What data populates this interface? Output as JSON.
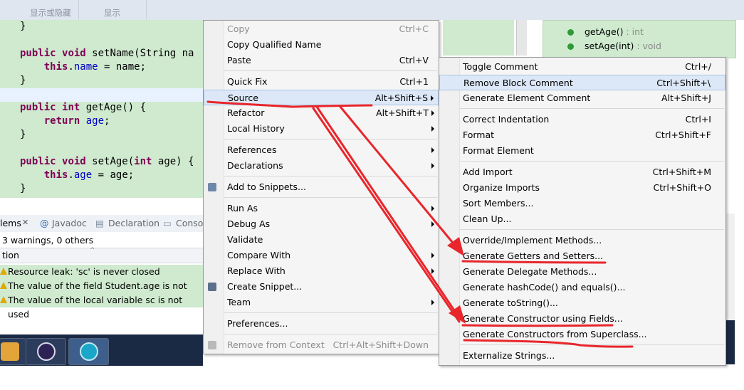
{
  "top_tabs": [
    "显示或隐藏",
    "显示"
  ],
  "editor": {
    "lines": [
      {
        "parts": [
          {
            "t": "}",
            "c": ""
          }
        ]
      },
      {
        "parts": []
      },
      {
        "parts": [
          {
            "t": "public",
            "c": "kw"
          },
          {
            "t": " ",
            "c": ""
          },
          {
            "t": "void",
            "c": "kw"
          },
          {
            "t": " setName(String na",
            "c": ""
          }
        ]
      },
      {
        "parts": [
          {
            "t": "    ",
            "c": ""
          },
          {
            "t": "this",
            "c": "kw"
          },
          {
            "t": ".",
            "c": ""
          },
          {
            "t": "name",
            "c": "fld"
          },
          {
            "t": " = name;",
            "c": ""
          }
        ]
      },
      {
        "parts": [
          {
            "t": "}",
            "c": ""
          }
        ]
      },
      {
        "parts": []
      },
      {
        "parts": [
          {
            "t": "public",
            "c": "kw"
          },
          {
            "t": " ",
            "c": ""
          },
          {
            "t": "int",
            "c": "kw"
          },
          {
            "t": " getAge() {",
            "c": ""
          }
        ]
      },
      {
        "parts": [
          {
            "t": "    ",
            "c": ""
          },
          {
            "t": "return",
            "c": "kw"
          },
          {
            "t": " ",
            "c": ""
          },
          {
            "t": "age",
            "c": "fld"
          },
          {
            "t": ";",
            "c": ""
          }
        ]
      },
      {
        "parts": [
          {
            "t": "}",
            "c": ""
          }
        ]
      },
      {
        "parts": []
      },
      {
        "parts": [
          {
            "t": "public",
            "c": "kw"
          },
          {
            "t": " ",
            "c": ""
          },
          {
            "t": "void",
            "c": "kw"
          },
          {
            "t": " setAge(",
            "c": ""
          },
          {
            "t": "int",
            "c": "kw"
          },
          {
            "t": " age) {",
            "c": ""
          }
        ]
      },
      {
        "parts": [
          {
            "t": "    ",
            "c": ""
          },
          {
            "t": "this",
            "c": "kw"
          },
          {
            "t": ".",
            "c": ""
          },
          {
            "t": "age",
            "c": "fld"
          },
          {
            "t": " = age;",
            "c": ""
          }
        ]
      },
      {
        "parts": [
          {
            "t": "}",
            "c": ""
          }
        ]
      }
    ]
  },
  "outline": {
    "items": [
      {
        "name": "getAge()",
        "type": " : int"
      },
      {
        "name": "setAge(int)",
        "type": " : void"
      }
    ]
  },
  "bottom_tabs": {
    "problems": "lems",
    "javadoc": "Javadoc",
    "declaration": "Declaration",
    "console": "Conso"
  },
  "problems": {
    "summary": "3 warnings, 0 others",
    "column": "tion",
    "warnings": [
      "Resource leak: 'sc' is never closed",
      "The value of the field Student.age is not used",
      "The value of the local variable sc is not used"
    ]
  },
  "context_menu": {
    "items": [
      {
        "label": "Copy",
        "shortcut": "Ctrl+C",
        "disabled": true
      },
      {
        "label": "Copy Qualified Name",
        "shortcut": ""
      },
      {
        "label": "Paste",
        "shortcut": "Ctrl+V"
      },
      {
        "label": "Quick Fix",
        "shortcut": "Ctrl+1"
      },
      {
        "label": "Source",
        "shortcut": "Alt+Shift+S",
        "submenu": true,
        "selected": true
      },
      {
        "label": "Refactor",
        "shortcut": "Alt+Shift+T",
        "submenu": true
      },
      {
        "label": "Local History",
        "shortcut": "",
        "submenu": true
      },
      {
        "label": "References",
        "shortcut": "",
        "submenu": true
      },
      {
        "label": "Declarations",
        "shortcut": "",
        "submenu": true
      },
      {
        "label": "Add to Snippets...",
        "shortcut": ""
      },
      {
        "label": "Run As",
        "shortcut": "",
        "submenu": true
      },
      {
        "label": "Debug As",
        "shortcut": "",
        "submenu": true
      },
      {
        "label": "Validate",
        "shortcut": ""
      },
      {
        "label": "Compare With",
        "shortcut": "",
        "submenu": true
      },
      {
        "label": "Replace With",
        "shortcut": "",
        "submenu": true
      },
      {
        "label": "Create Snippet...",
        "shortcut": ""
      },
      {
        "label": "Team",
        "shortcut": "",
        "submenu": true
      },
      {
        "label": "Preferences...",
        "shortcut": ""
      },
      {
        "label": "Remove from Context",
        "shortcut": "Ctrl+Alt+Shift+Down",
        "disabled": true
      }
    ]
  },
  "source_menu": {
    "items": [
      {
        "label": "Toggle Comment",
        "shortcut": "Ctrl+/"
      },
      {
        "label": "Remove Block Comment",
        "shortcut": "Ctrl+Shift+\\",
        "selected": true
      },
      {
        "label": "Generate Element Comment",
        "shortcut": "Alt+Shift+J"
      },
      {
        "label": "Correct Indentation",
        "shortcut": "Ctrl+I"
      },
      {
        "label": "Format",
        "shortcut": "Ctrl+Shift+F"
      },
      {
        "label": "Format Element",
        "shortcut": ""
      },
      {
        "label": "Add Import",
        "shortcut": "Ctrl+Shift+M"
      },
      {
        "label": "Organize Imports",
        "shortcut": "Ctrl+Shift+O"
      },
      {
        "label": "Sort Members...",
        "shortcut": ""
      },
      {
        "label": "Clean Up...",
        "shortcut": ""
      },
      {
        "label": "Override/Implement Methods...",
        "shortcut": ""
      },
      {
        "label": "Generate Getters and Setters...",
        "shortcut": ""
      },
      {
        "label": "Generate Delegate Methods...",
        "shortcut": ""
      },
      {
        "label": "Generate hashCode() and equals()...",
        "shortcut": ""
      },
      {
        "label": "Generate toString()...",
        "shortcut": ""
      },
      {
        "label": "Generate Constructor using Fields...",
        "shortcut": ""
      },
      {
        "label": "Generate Constructors from Superclass...",
        "shortcut": ""
      },
      {
        "label": "Externalize Strings...",
        "shortcut": ""
      }
    ]
  },
  "colors": {
    "annotation_red": "#e8262b",
    "editor_bg": "#cfeacf",
    "menu_bg": "#f5f5f5",
    "selection": "#dce8f7"
  }
}
